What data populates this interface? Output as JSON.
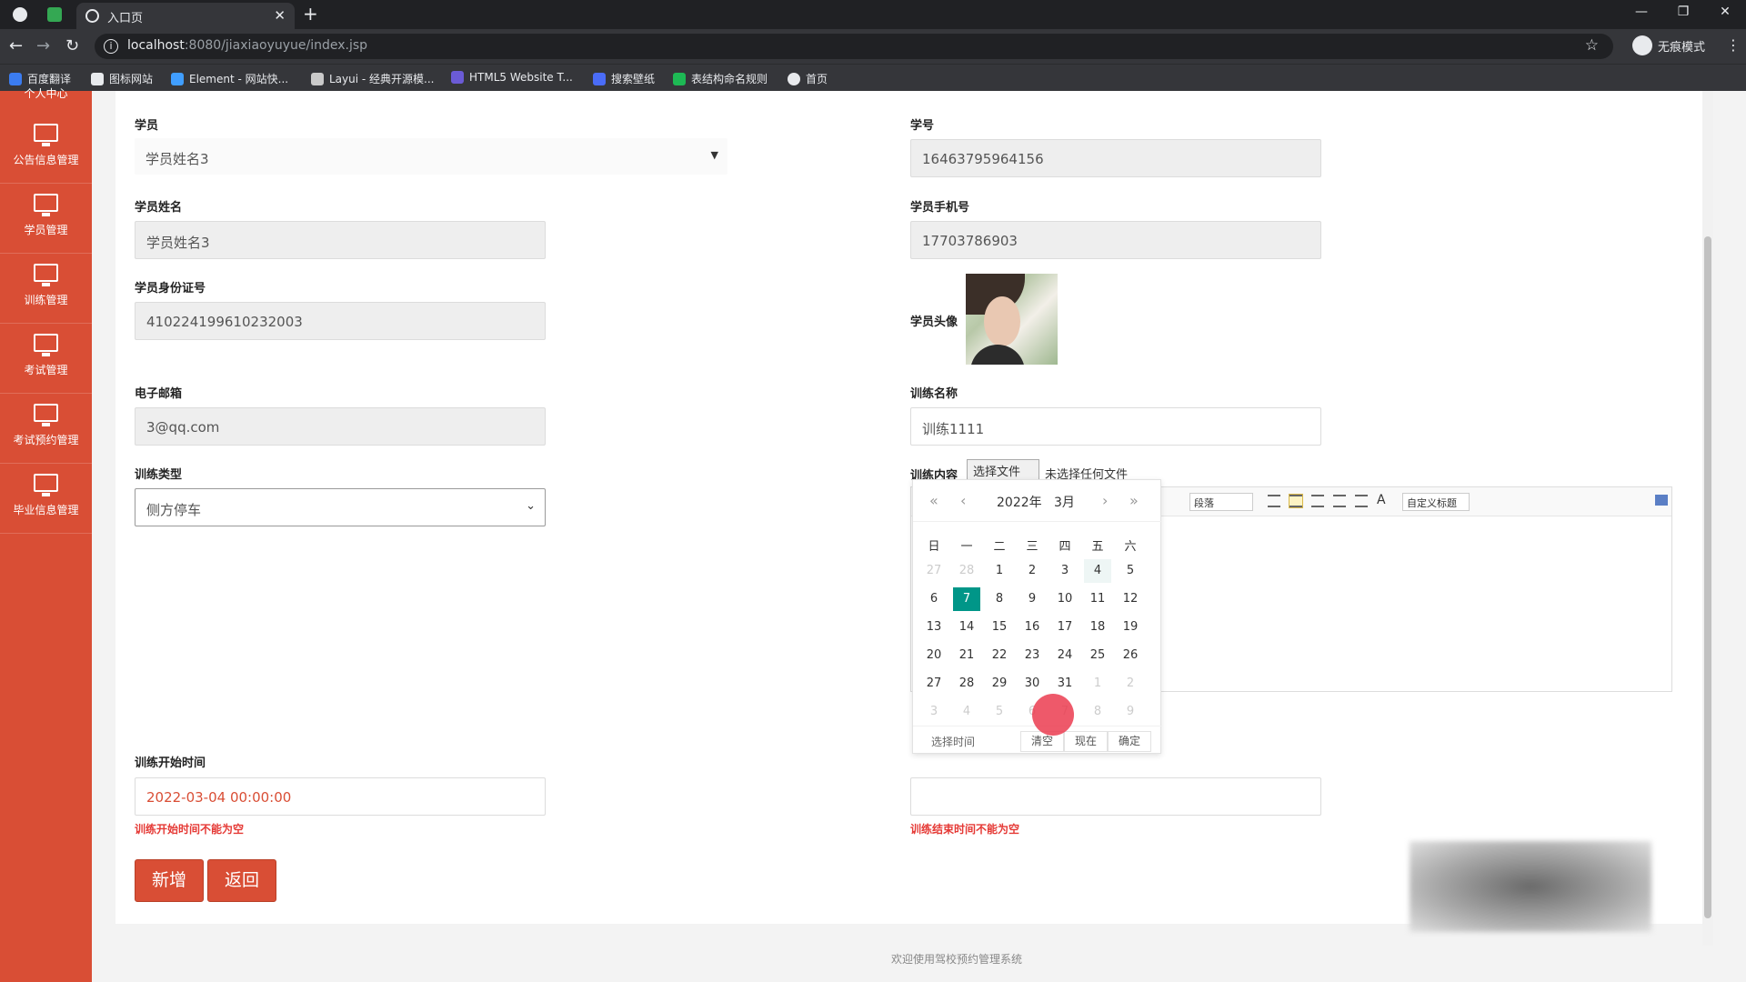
{
  "browser": {
    "tab_title": "入口页",
    "url_host": "localhost",
    "url_path": ":8080/jiaxiaoyuyue/index.jsp",
    "incognito_label": "无痕模式",
    "bookmarks": [
      "百度翻译",
      "图标网站",
      "Element - 网站快...",
      "Layui - 经典开源模...",
      "HTML5 Website T...",
      "搜索壁纸",
      "表结构命名规则",
      "首页"
    ]
  },
  "sidebar": {
    "top_label": "个人中心",
    "items": [
      "公告信息管理",
      "学员管理",
      "训练管理",
      "考试管理",
      "考试预约管理",
      "毕业信息管理"
    ]
  },
  "form": {
    "student_label": "学员",
    "student_value": "学员姓名3",
    "student_no_label": "学号",
    "student_no_value": "16463795964156",
    "name_label": "学员姓名",
    "name_value": "学员姓名3",
    "phone_label": "学员手机号",
    "phone_value": "17703786903",
    "idcard_label": "学员身份证号",
    "idcard_value": "410224199610232003",
    "avatar_label": "学员头像",
    "email_label": "电子邮箱",
    "email_value": "3@qq.com",
    "train_name_label": "训练名称",
    "train_name_value": "训练1111",
    "train_type_label": "训练类型",
    "train_type_value": "侧方停车",
    "content_label": "训练内容",
    "file_button": "选择文件",
    "file_status": "未选择任何文件",
    "editor_paragraph": "段落",
    "editor_custom_title": "自定义标题",
    "editor_font_icon": "A",
    "start_time_label": "训练开始时间",
    "start_time_value": "2022-03-04 00:00:00",
    "start_time_error": "训练开始时间不能为空",
    "end_time_error": "训练结束时间不能为空",
    "add_button": "新增",
    "back_button": "返回"
  },
  "datepicker": {
    "year": "2022年",
    "month": "3月",
    "weekdays": [
      "日",
      "一",
      "二",
      "三",
      "四",
      "五",
      "六"
    ],
    "rows": [
      [
        "27",
        "28",
        "1",
        "2",
        "3",
        "4",
        "5"
      ],
      [
        "6",
        "7",
        "8",
        "9",
        "10",
        "11",
        "12"
      ],
      [
        "13",
        "14",
        "15",
        "16",
        "17",
        "18",
        "19"
      ],
      [
        "20",
        "21",
        "22",
        "23",
        "24",
        "25",
        "26"
      ],
      [
        "27",
        "28",
        "29",
        "30",
        "31",
        "1",
        "2"
      ],
      [
        "3",
        "4",
        "5",
        "6",
        "7",
        "8",
        "9"
      ]
    ],
    "select_time": "选择时间",
    "clear": "清空",
    "now": "现在",
    "confirm": "确定",
    "selected_day": "7",
    "accent_color": "#009688"
  },
  "footer": {
    "text": "欢迎使用驾校预约管理系统"
  },
  "theme": {
    "primary": "#d94e35",
    "error": "#e53935"
  }
}
